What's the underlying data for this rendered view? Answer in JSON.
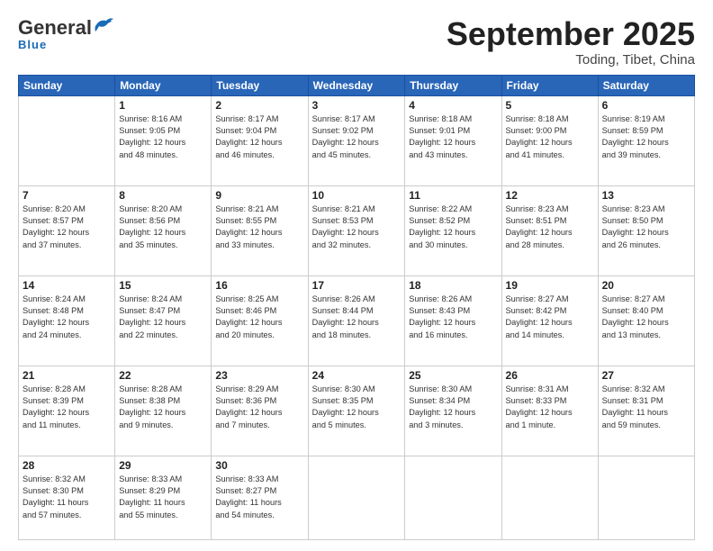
{
  "header": {
    "logo_general": "General",
    "logo_blue": "Blue",
    "month": "September 2025",
    "location": "Toding, Tibet, China"
  },
  "weekdays": [
    "Sunday",
    "Monday",
    "Tuesday",
    "Wednesday",
    "Thursday",
    "Friday",
    "Saturday"
  ],
  "weeks": [
    [
      {
        "day": null,
        "info": null
      },
      {
        "day": "1",
        "info": "Sunrise: 8:16 AM\nSunset: 9:05 PM\nDaylight: 12 hours\nand 48 minutes."
      },
      {
        "day": "2",
        "info": "Sunrise: 8:17 AM\nSunset: 9:04 PM\nDaylight: 12 hours\nand 46 minutes."
      },
      {
        "day": "3",
        "info": "Sunrise: 8:17 AM\nSunset: 9:02 PM\nDaylight: 12 hours\nand 45 minutes."
      },
      {
        "day": "4",
        "info": "Sunrise: 8:18 AM\nSunset: 9:01 PM\nDaylight: 12 hours\nand 43 minutes."
      },
      {
        "day": "5",
        "info": "Sunrise: 8:18 AM\nSunset: 9:00 PM\nDaylight: 12 hours\nand 41 minutes."
      },
      {
        "day": "6",
        "info": "Sunrise: 8:19 AM\nSunset: 8:59 PM\nDaylight: 12 hours\nand 39 minutes."
      }
    ],
    [
      {
        "day": "7",
        "info": "Sunrise: 8:20 AM\nSunset: 8:57 PM\nDaylight: 12 hours\nand 37 minutes."
      },
      {
        "day": "8",
        "info": "Sunrise: 8:20 AM\nSunset: 8:56 PM\nDaylight: 12 hours\nand 35 minutes."
      },
      {
        "day": "9",
        "info": "Sunrise: 8:21 AM\nSunset: 8:55 PM\nDaylight: 12 hours\nand 33 minutes."
      },
      {
        "day": "10",
        "info": "Sunrise: 8:21 AM\nSunset: 8:53 PM\nDaylight: 12 hours\nand 32 minutes."
      },
      {
        "day": "11",
        "info": "Sunrise: 8:22 AM\nSunset: 8:52 PM\nDaylight: 12 hours\nand 30 minutes."
      },
      {
        "day": "12",
        "info": "Sunrise: 8:23 AM\nSunset: 8:51 PM\nDaylight: 12 hours\nand 28 minutes."
      },
      {
        "day": "13",
        "info": "Sunrise: 8:23 AM\nSunset: 8:50 PM\nDaylight: 12 hours\nand 26 minutes."
      }
    ],
    [
      {
        "day": "14",
        "info": "Sunrise: 8:24 AM\nSunset: 8:48 PM\nDaylight: 12 hours\nand 24 minutes."
      },
      {
        "day": "15",
        "info": "Sunrise: 8:24 AM\nSunset: 8:47 PM\nDaylight: 12 hours\nand 22 minutes."
      },
      {
        "day": "16",
        "info": "Sunrise: 8:25 AM\nSunset: 8:46 PM\nDaylight: 12 hours\nand 20 minutes."
      },
      {
        "day": "17",
        "info": "Sunrise: 8:26 AM\nSunset: 8:44 PM\nDaylight: 12 hours\nand 18 minutes."
      },
      {
        "day": "18",
        "info": "Sunrise: 8:26 AM\nSunset: 8:43 PM\nDaylight: 12 hours\nand 16 minutes."
      },
      {
        "day": "19",
        "info": "Sunrise: 8:27 AM\nSunset: 8:42 PM\nDaylight: 12 hours\nand 14 minutes."
      },
      {
        "day": "20",
        "info": "Sunrise: 8:27 AM\nSunset: 8:40 PM\nDaylight: 12 hours\nand 13 minutes."
      }
    ],
    [
      {
        "day": "21",
        "info": "Sunrise: 8:28 AM\nSunset: 8:39 PM\nDaylight: 12 hours\nand 11 minutes."
      },
      {
        "day": "22",
        "info": "Sunrise: 8:28 AM\nSunset: 8:38 PM\nDaylight: 12 hours\nand 9 minutes."
      },
      {
        "day": "23",
        "info": "Sunrise: 8:29 AM\nSunset: 8:36 PM\nDaylight: 12 hours\nand 7 minutes."
      },
      {
        "day": "24",
        "info": "Sunrise: 8:30 AM\nSunset: 8:35 PM\nDaylight: 12 hours\nand 5 minutes."
      },
      {
        "day": "25",
        "info": "Sunrise: 8:30 AM\nSunset: 8:34 PM\nDaylight: 12 hours\nand 3 minutes."
      },
      {
        "day": "26",
        "info": "Sunrise: 8:31 AM\nSunset: 8:33 PM\nDaylight: 12 hours\nand 1 minute."
      },
      {
        "day": "27",
        "info": "Sunrise: 8:32 AM\nSunset: 8:31 PM\nDaylight: 11 hours\nand 59 minutes."
      }
    ],
    [
      {
        "day": "28",
        "info": "Sunrise: 8:32 AM\nSunset: 8:30 PM\nDaylight: 11 hours\nand 57 minutes."
      },
      {
        "day": "29",
        "info": "Sunrise: 8:33 AM\nSunset: 8:29 PM\nDaylight: 11 hours\nand 55 minutes."
      },
      {
        "day": "30",
        "info": "Sunrise: 8:33 AM\nSunset: 8:27 PM\nDaylight: 11 hours\nand 54 minutes."
      },
      {
        "day": null,
        "info": null
      },
      {
        "day": null,
        "info": null
      },
      {
        "day": null,
        "info": null
      },
      {
        "day": null,
        "info": null
      }
    ]
  ]
}
